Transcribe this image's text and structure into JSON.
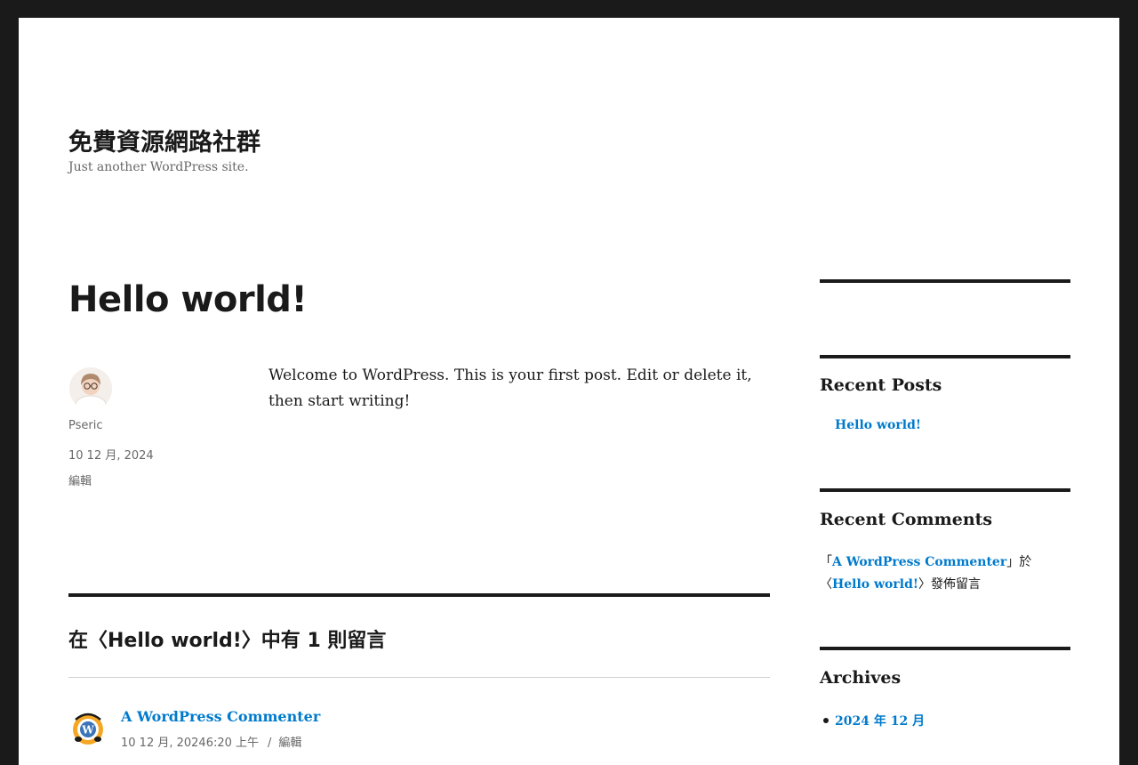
{
  "site": {
    "title": "免費資源網路社群",
    "description": "Just another WordPress site."
  },
  "post": {
    "title": "Hello world!",
    "author": "Pseric",
    "date": "10 12 月, 2024",
    "edit_label": "編輯",
    "content": "Welcome to WordPress. This is your first post. Edit or delete it, then start writing!"
  },
  "comments": {
    "heading": "在〈Hello world!〉中有 1 則留言",
    "items": [
      {
        "author": "A WordPress Commenter",
        "datetime": "10 12 月, 20246:20 上午",
        "separator": "/",
        "edit_label": "編輯",
        "avatar_icon": "wordpress-commenter-avatar-icon"
      }
    ]
  },
  "sidebar": {
    "recent_posts": {
      "title": "Recent Posts",
      "items": [
        "Hello world!"
      ]
    },
    "recent_comments": {
      "title": "Recent Comments",
      "open_quote": "「",
      "author": "A WordPress Commenter",
      "middle": "」於〈",
      "post": "Hello world!",
      "suffix": "〉發佈留言"
    },
    "archives": {
      "title": "Archives",
      "items": [
        "2024 年 12 月"
      ]
    }
  },
  "colors": {
    "link": "#007acc",
    "text": "#1a1a1a",
    "meta": "#686868",
    "frame": "#1a1a1a"
  }
}
